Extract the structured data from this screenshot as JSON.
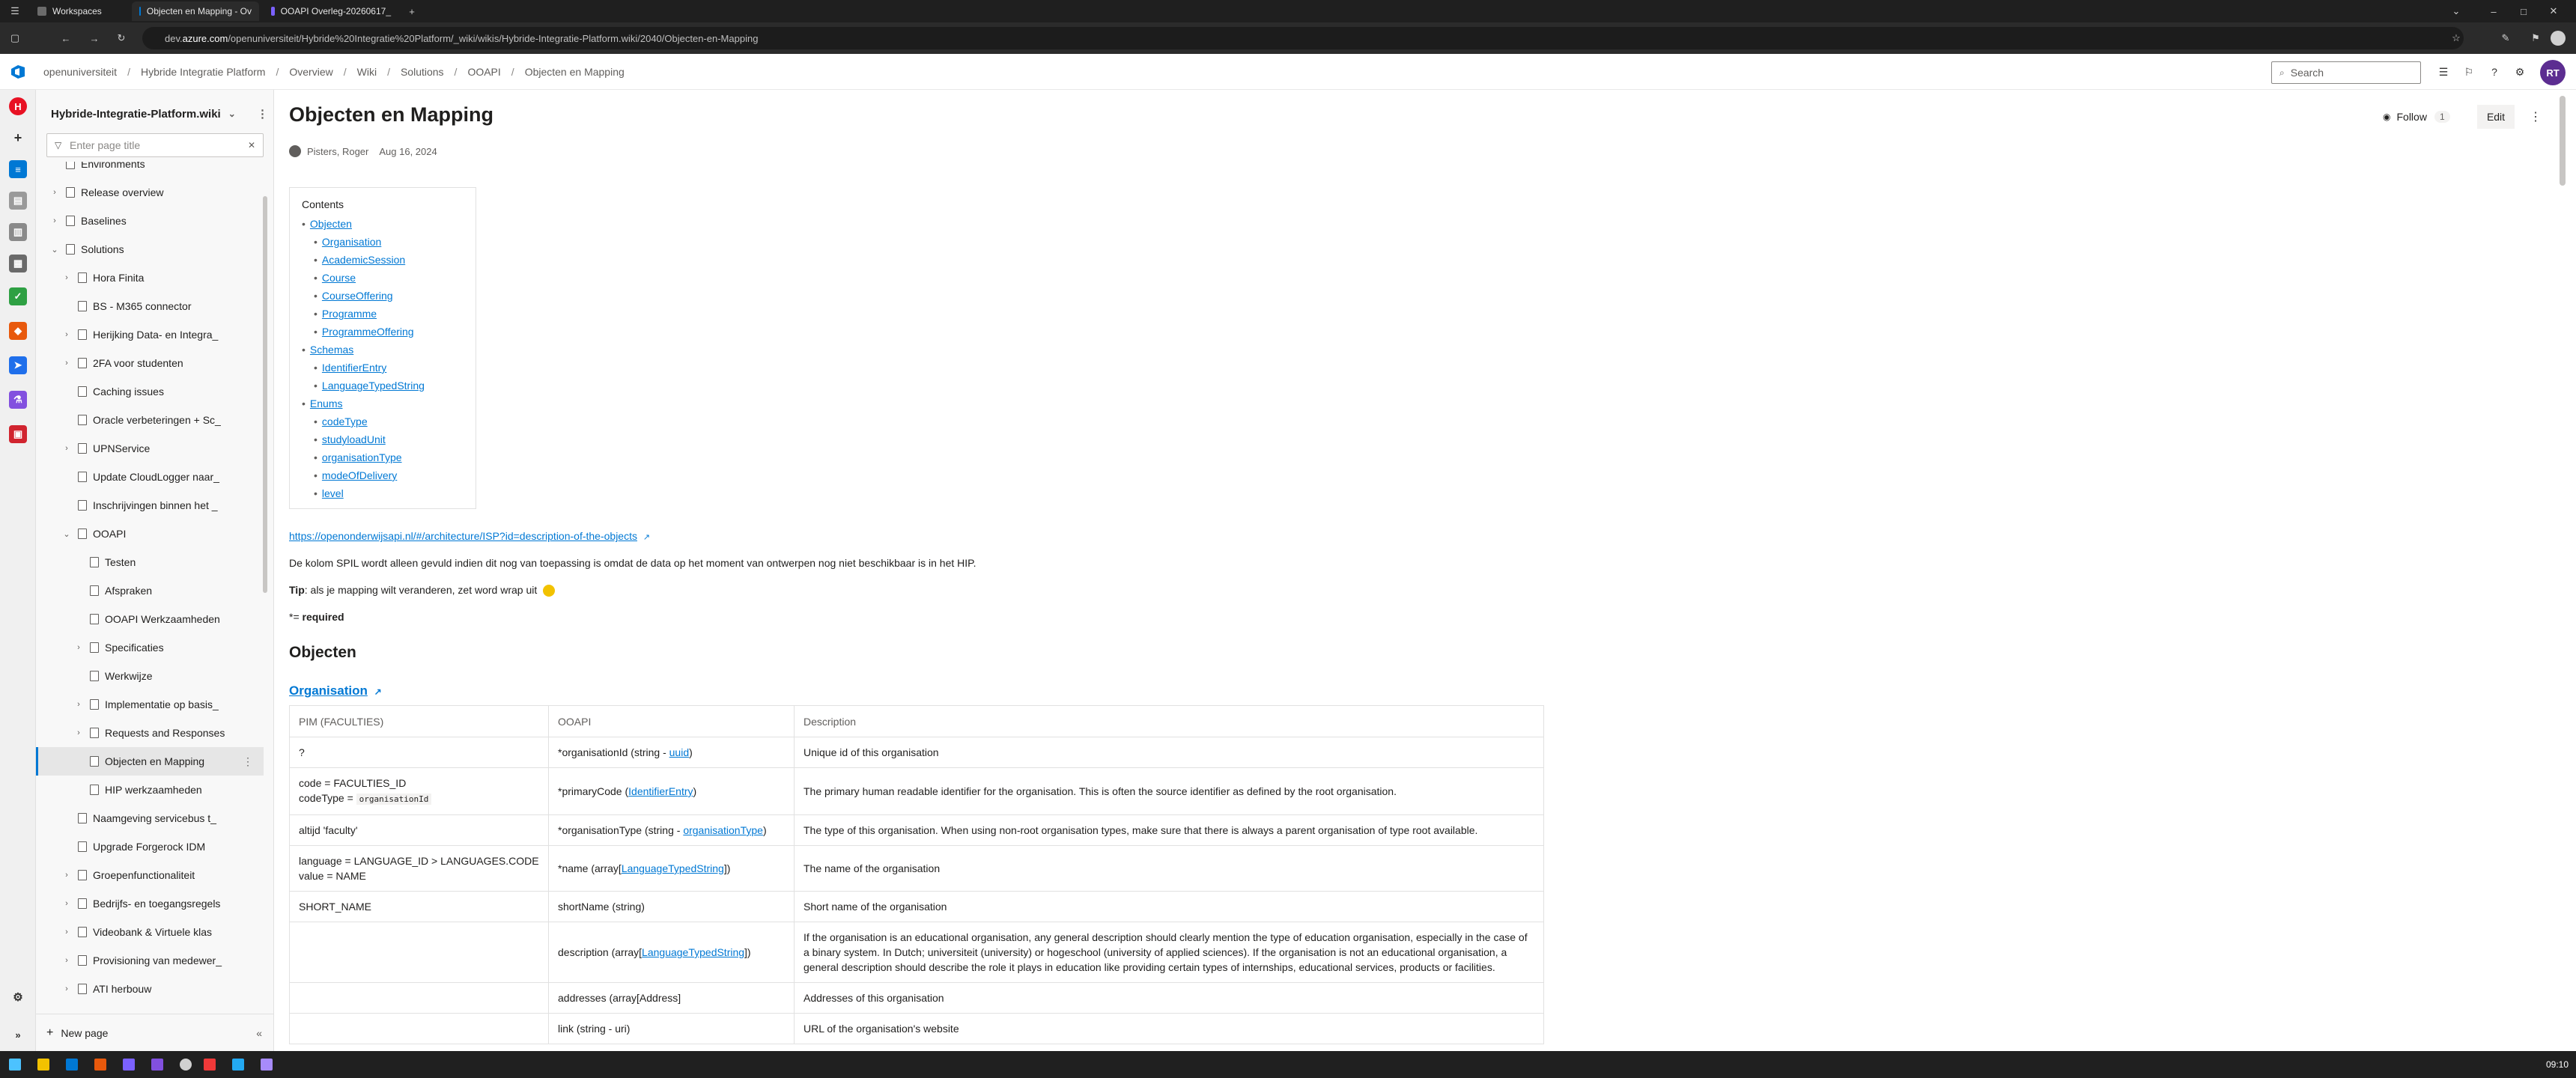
{
  "browser": {
    "tabs": [
      {
        "label": "Workspaces",
        "active": false
      },
      {
        "label": "Objecten en Mapping - Ov",
        "active": true
      },
      {
        "label": "OOAPI Overleg-20260617_",
        "active": false
      }
    ],
    "url_prefix": "dev.",
    "url_domain": "azure.com",
    "url_rest": "/openuniversiteit/Hybride%20Integratie%20Platform/_wiki/wikis/Hybride-Integratie-Platform.wiki/2040/Objecten-en-Mapping"
  },
  "ado": {
    "breadcrumb": [
      "openuniversiteit",
      "Hybride Integratie Platform",
      "Overview",
      "Wiki",
      "Solutions",
      "OOAPI",
      "Objecten en Mapping"
    ],
    "search_placeholder": "Search",
    "avatar_initials": "RT",
    "accent_color": "#0078d4"
  },
  "wiki": {
    "name": "Hybride-Integratie-Platform.wiki",
    "filter_placeholder": "Enter page title",
    "tree": [
      {
        "label": "Environments",
        "level": 0,
        "chevron": ""
      },
      {
        "label": "Release overview",
        "level": 0,
        "chevron": ">"
      },
      {
        "label": "Baselines",
        "level": 0,
        "chevron": ">"
      },
      {
        "label": "Solutions",
        "level": 0,
        "chevron": "v"
      },
      {
        "label": "Hora Finita",
        "level": 1,
        "chevron": ">"
      },
      {
        "label": "BS - M365 connector",
        "level": 1,
        "chevron": ""
      },
      {
        "label": "Herijking Data- en Integra_",
        "level": 1,
        "chevron": ">"
      },
      {
        "label": "2FA voor studenten",
        "level": 1,
        "chevron": ">"
      },
      {
        "label": "Caching issues",
        "level": 1,
        "chevron": ""
      },
      {
        "label": "Oracle verbeteringen + Sc_",
        "level": 1,
        "chevron": ""
      },
      {
        "label": "UPNService",
        "level": 1,
        "chevron": ">"
      },
      {
        "label": "Update CloudLogger naar_",
        "level": 1,
        "chevron": ""
      },
      {
        "label": "Inschrijvingen binnen het _",
        "level": 1,
        "chevron": ""
      },
      {
        "label": "OOAPI",
        "level": 1,
        "chevron": "v"
      },
      {
        "label": "Testen",
        "level": 2,
        "chevron": ""
      },
      {
        "label": "Afspraken",
        "level": 2,
        "chevron": ""
      },
      {
        "label": "OOAPI Werkzaamheden",
        "level": 2,
        "chevron": ""
      },
      {
        "label": "Specificaties",
        "level": 2,
        "chevron": ">"
      },
      {
        "label": "Werkwijze",
        "level": 2,
        "chevron": ""
      },
      {
        "label": "Implementatie op basis_",
        "level": 2,
        "chevron": ">"
      },
      {
        "label": "Requests and Responses",
        "level": 2,
        "chevron": ">"
      },
      {
        "label": "Objecten en Mapping",
        "level": 2,
        "chevron": "",
        "selected": true
      },
      {
        "label": "HIP werkzaamheden",
        "level": 2,
        "chevron": ""
      },
      {
        "label": "Naamgeving servicebus t_",
        "level": 1,
        "chevron": ""
      },
      {
        "label": "Upgrade Forgerock IDM",
        "level": 1,
        "chevron": ""
      },
      {
        "label": "Groepenfunctionaliteit",
        "level": 1,
        "chevron": ">"
      },
      {
        "label": "Bedrijfs- en toegangsregels",
        "level": 1,
        "chevron": ">"
      },
      {
        "label": "Videobank & Virtuele klas",
        "level": 1,
        "chevron": ">"
      },
      {
        "label": "Provisioning van medewer_",
        "level": 1,
        "chevron": ">"
      },
      {
        "label": "ATI herbouw",
        "level": 1,
        "chevron": ">"
      }
    ],
    "new_page_label": "New page"
  },
  "page": {
    "title": "Objecten en Mapping",
    "author": "Pisters, Roger",
    "date": "Aug 16, 2024",
    "follow_label": "Follow",
    "follow_count": "1",
    "edit_label": "Edit",
    "toc_heading": "Contents",
    "toc": [
      {
        "label": "Objecten",
        "level": 0
      },
      {
        "label": "Organisation",
        "level": 1
      },
      {
        "label": "AcademicSession",
        "level": 1
      },
      {
        "label": "Course",
        "level": 1
      },
      {
        "label": "CourseOffering",
        "level": 1
      },
      {
        "label": "Programme",
        "level": 1
      },
      {
        "label": "ProgrammeOffering",
        "level": 1
      },
      {
        "label": "Schemas",
        "level": 0
      },
      {
        "label": "IdentifierEntry",
        "level": 1
      },
      {
        "label": "LanguageTypedString",
        "level": 1
      },
      {
        "label": "Enums",
        "level": 0
      },
      {
        "label": "codeType",
        "level": 1
      },
      {
        "label": "studyloadUnit",
        "level": 1
      },
      {
        "label": "organisationType",
        "level": 1
      },
      {
        "label": "modeOfDelivery",
        "level": 1
      },
      {
        "label": "level",
        "level": 1
      }
    ],
    "link": "https://openonderwijsapi.nl/#/architecture/ISP?id=description-of-the-objects",
    "note": "De kolom SPIL wordt alleen gevuld indien dit nog van toepassing is omdat de data op het moment van ontwerpen nog niet beschikbaar is in het HIP.",
    "tip_label": "Tip",
    "tip_text": ": als je mapping wilt veranderen, zet word wrap uit",
    "required_prefix": "*= ",
    "required_label": "required",
    "section_heading": "Objecten",
    "subsection_heading": "Organisation",
    "table": {
      "headers": [
        "PIM (FACULTIES)",
        "OOAPI",
        "Description"
      ],
      "rows": [
        {
          "pim": "?",
          "pim2": "",
          "pim_code": "",
          "ooapi_pre": "*organisationId (string - ",
          "ooapi_link": "uuid",
          "ooapi_post": ")",
          "desc": "Unique id of this organisation"
        },
        {
          "pim": "code = FACULTIES_ID",
          "pim2": "codeType = ",
          "pim_code": "organisationId",
          "ooapi_pre": "*primaryCode (",
          "ooapi_link": "IdentifierEntry",
          "ooapi_post": ")",
          "desc": "The primary human readable identifier for the organisation. This is often the source identifier as defined by the root organisation."
        },
        {
          "pim": "altijd 'faculty'",
          "pim2": "",
          "pim_code": "",
          "ooapi_pre": "*organisationType (string - ",
          "ooapi_link": "organisationType",
          "ooapi_post": ")",
          "desc": "The type of this organisation. When using non-root organisation types, make sure that there is always a parent organisation of type root available."
        },
        {
          "pim": "language = LANGUAGE_ID > LANGUAGES.CODE",
          "pim2": "value = NAME",
          "pim_code": "",
          "ooapi_pre": "*name (array[",
          "ooapi_link": "LanguageTypedString",
          "ooapi_post": "])",
          "desc": "The name of the organisation"
        },
        {
          "pim": "SHORT_NAME",
          "pim2": "",
          "pim_code": "",
          "ooapi_pre": "shortName (string)",
          "ooapi_link": "",
          "ooapi_post": "",
          "desc": "Short name of the organisation"
        },
        {
          "pim": "",
          "pim2": "",
          "pim_code": "",
          "ooapi_pre": "description (array[",
          "ooapi_link": "LanguageTypedString",
          "ooapi_post": "])",
          "desc": "If the organisation is an educational organisation, any general description should clearly mention the type of education organisation, especially in the case of a binary system. In Dutch; universiteit (university) or hogeschool (university of applied sciences). If the organisation is not an educational organisation, a general description should describe the role it plays in education like providing certain types of internships, educational services, products or facilities."
        },
        {
          "pim": "",
          "pim2": "",
          "pim_code": "",
          "ooapi_pre": "addresses (array[Address]",
          "ooapi_link": "",
          "ooapi_post": "",
          "desc": "Addresses of this organisation"
        },
        {
          "pim": "",
          "pim2": "",
          "pim_code": "",
          "ooapi_pre": "link (string - uri)",
          "ooapi_link": "",
          "ooapi_post": "",
          "desc": "URL of the organisation's website"
        }
      ]
    }
  },
  "taskbar": {
    "time": "09:10"
  }
}
